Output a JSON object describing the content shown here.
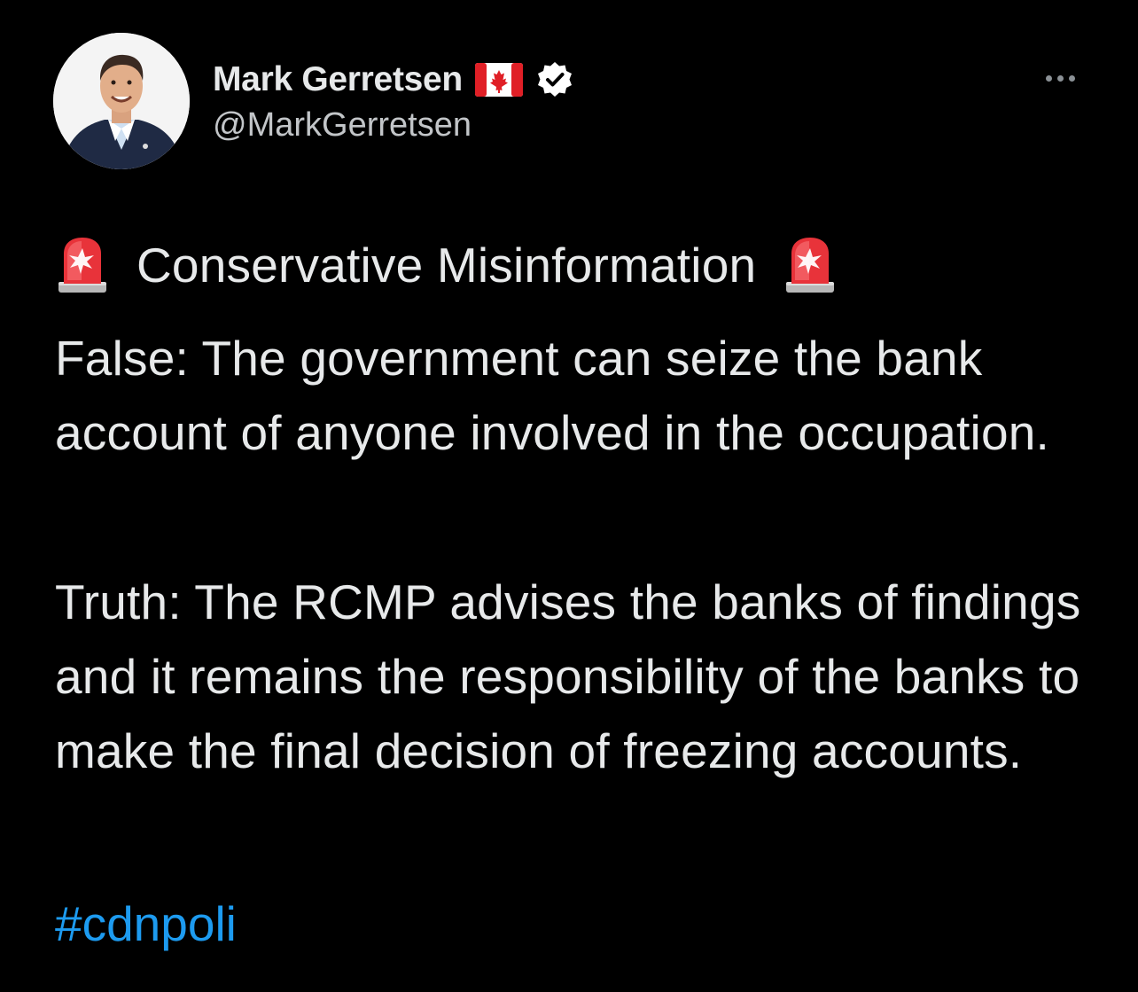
{
  "author": {
    "display_name": "Mark Gerretsen",
    "handle": "@MarkGerretsen",
    "avatar_icon": "profile-photo",
    "flag_icon": "canada-flag",
    "verified_icon": "verified-badge"
  },
  "menu_icon": "more-options-icon",
  "tweet": {
    "headline": "Conservative Misinformation",
    "headline_icon": "police-siren-emoji",
    "false_claim": "False: The government can seize the bank account of anyone involved in the occupation.",
    "truth": "Truth: The RCMP advises the banks of findings and it remains the responsibility of the banks to make the final decision of freezing accounts.",
    "hashtag": "#cdnpoli"
  },
  "colors": {
    "background": "#000000",
    "text": "#e7e9ea",
    "secondary_text": "#c2c5c8",
    "link": "#1d9bf0",
    "siren_red": "#e8333a"
  }
}
